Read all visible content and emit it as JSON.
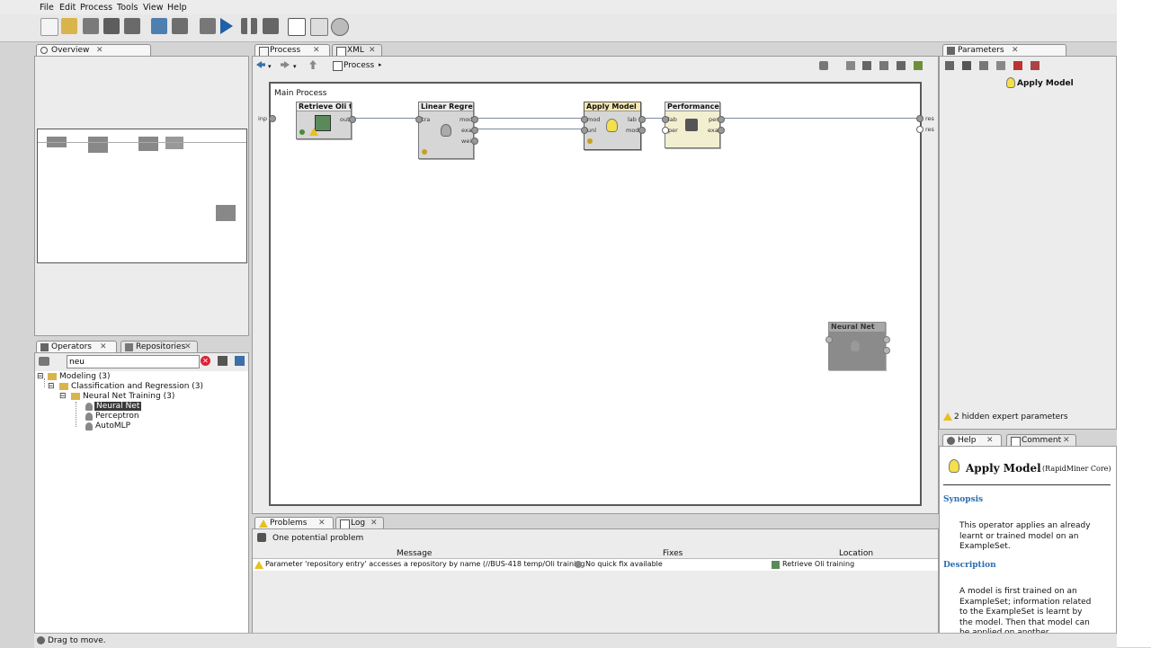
{
  "menu": {
    "file": "File",
    "edit": "Edit",
    "process": "Process",
    "tools": "Tools",
    "view": "View",
    "help": "Help"
  },
  "tabs": {
    "overview": "Overview",
    "process": "Process",
    "xml": "XML",
    "parameters": "Parameters",
    "operators": "Operators",
    "repositories": "Repositories",
    "problems": "Problems",
    "log": "Log",
    "help": "Help",
    "comment": "Comment",
    "close": "✕"
  },
  "process_nav": {
    "breadcrumb": "Process"
  },
  "canvas": {
    "title": "Main Process",
    "inp_label": "inp",
    "res_label_1": "res",
    "res_label_2": "res",
    "operators": [
      {
        "name": "Retrieve Oli tr...",
        "ports_out": [
          "out"
        ]
      },
      {
        "name": "Linear Regress...",
        "ports_in": [
          "tra"
        ],
        "ports_out": [
          "mod",
          "exa",
          "wei"
        ]
      },
      {
        "name": "Apply Model",
        "ports_in": [
          "mod",
          "unl"
        ],
        "ports_out": [
          "lab",
          "mod"
        ]
      },
      {
        "name": "Performance",
        "ports_in": [
          "lab",
          "per"
        ],
        "ports_out": [
          "per",
          "exa"
        ]
      },
      {
        "name": "Neural Net"
      }
    ]
  },
  "operators_panel": {
    "search_value": "neu",
    "tree": [
      {
        "label": "Modeling (3)"
      },
      {
        "label": "Classification and Regression (3)"
      },
      {
        "label": "Neural Net Training (3)"
      },
      {
        "label": "Neural Net"
      },
      {
        "label": "Perceptron"
      },
      {
        "label": "AutoMLP"
      }
    ]
  },
  "parameters": {
    "operator_title": "Apply Model",
    "hidden_params": "2 hidden expert parameters"
  },
  "problems": {
    "summary": "One potential problem",
    "headers": {
      "message": "Message",
      "fixes": "Fixes",
      "location": "Location"
    },
    "row": {
      "message": "Parameter 'repository entry' accesses a repository by name (//BUS-418 temp/Oli training). ...",
      "fixes": "No quick fix available",
      "location": "Retrieve Oli training"
    }
  },
  "help": {
    "title": "Apply Model",
    "source": "(RapidMiner Core)",
    "synopsis_heading": "Synopsis",
    "synopsis": "This operator applies an already learnt or trained model on an ExampleSet.",
    "description_heading": "Description",
    "description": "A model is first trained on an ExampleSet; information related to the ExampleSet is learnt by the model. Then that model can be applied on another ExampleSet."
  },
  "status": {
    "text": "Drag to move."
  },
  "colors": {
    "accent": "#2a6fb3",
    "canvas_border": "#5a5a5a",
    "warning": "#e8c020"
  },
  "icons": [
    "new-icon",
    "open-icon",
    "save-icon",
    "run-icon",
    "pause-icon",
    "stop-icon",
    "wizard-icon",
    "lightbulb-icon",
    "warning-icon",
    "search-icon",
    "clear-icon",
    "back-icon",
    "forward-icon",
    "up-icon"
  ]
}
